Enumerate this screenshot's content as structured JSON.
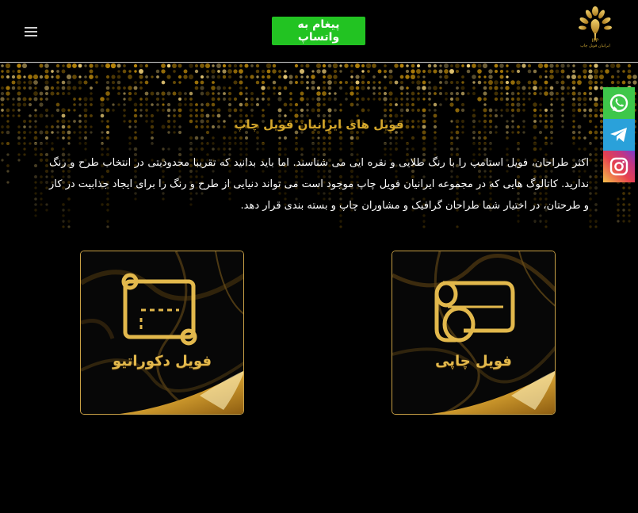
{
  "header": {
    "whatsapp_button": "پیغام به واتساپ",
    "logo": {
      "abbr": "IFP",
      "name": "ایرانیان فویل چاپ"
    }
  },
  "hero": {
    "title": "فویل های ایرانیان فویل چاپ",
    "paragraph": "اکثر طراحان، فویل استامپ را با رنگ طلایی و نقره ایی می شناسند. اما باید بدانید که تقریبا محدودیتی در انتخاب طرح و رنگ ندارید. کاتالوگ هایی که در مجموعه ایرانیان فویل چاپ موجود است می تواند دنیایی از طرح و رنگ را برای ایجاد جذابیت در کار و طرحتان، در اختیار شما طراحان گرافیک و مشاوران چاپ و بسته بندی قرار دهد."
  },
  "side_bar": {
    "items": [
      {
        "icon": "whatsapp-icon",
        "color": "#3ec74a"
      },
      {
        "icon": "telegram-icon",
        "color": "#2aa1da"
      },
      {
        "icon": "instagram-icon",
        "color": "#e7424e"
      }
    ]
  },
  "cards": [
    {
      "label": "فویل دکوراتیو",
      "icon": "decorative-foil-scroll-icon"
    },
    {
      "label": "فویل چاپی",
      "icon": "printing-foil-roll-icon"
    }
  ],
  "colors": {
    "gold": "#d4a72c",
    "background": "#000000",
    "whatsapp_green": "#22c322"
  }
}
